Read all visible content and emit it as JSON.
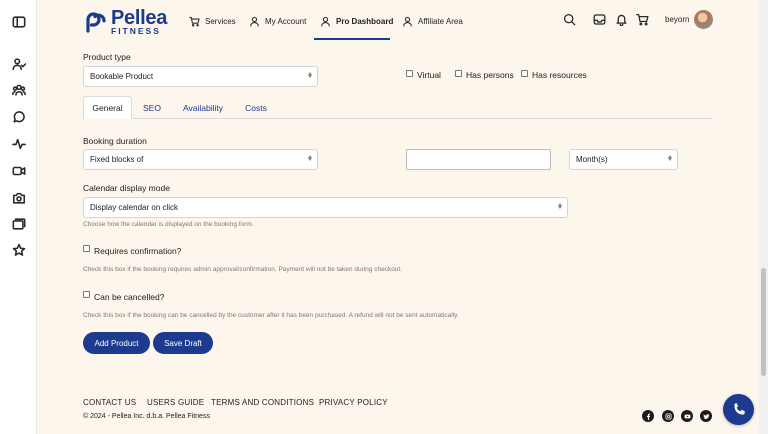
{
  "app": {
    "name": "Pellea",
    "tagline": "FITNESS"
  },
  "sidebar": {
    "items": [
      {
        "icon": "sidebar-toggle-icon"
      },
      {
        "icon": "users-icon"
      },
      {
        "icon": "groups-icon"
      },
      {
        "icon": "chat-icon"
      },
      {
        "icon": "activity-icon"
      },
      {
        "icon": "video-icon"
      },
      {
        "icon": "camera-icon"
      },
      {
        "icon": "gallery-icon"
      },
      {
        "icon": "star-icon"
      }
    ]
  },
  "nav": {
    "services": "Services",
    "my_account": "My Account",
    "pro_dashboard": "Pro Dashboard",
    "affiliate": "Affiliate Area",
    "active": "pro_dashboard"
  },
  "header": {
    "username": "beyorn"
  },
  "form": {
    "product_type_label": "Product type",
    "product_type_value": "Bookable Product",
    "virtual_label": "Virtual",
    "virtual_checked": false,
    "has_persons_label": "Has persons",
    "has_persons_checked": false,
    "has_resources_label": "Has resources",
    "has_resources_checked": false,
    "tabs": [
      "General",
      "SEO",
      "Availability",
      "Costs"
    ],
    "active_tab": "General",
    "booking_duration_label": "Booking duration",
    "booking_duration_type": "Fixed blocks of",
    "booking_duration_value": "",
    "booking_duration_unit": "Month(s)",
    "calendar_mode_label": "Calendar display mode",
    "calendar_mode_value": "Display calendar on click",
    "calendar_mode_help": "Choose how the calendar is displayed on the booking form.",
    "requires_confirmation_label": "Requires confirmation?",
    "requires_confirmation_checked": false,
    "requires_confirmation_help": "Check this box if the booking requires admin approval/confirmation. Payment will not be taken during checkout.",
    "can_be_cancelled_label": "Can be cancelled?",
    "can_be_cancelled_checked": false,
    "can_be_cancelled_help": "Check this box if the booking can be cancelled by the customer after it has been purchased. A refund will not be sent automatically.",
    "add_product": "Add Product",
    "save_draft": "Save Draft"
  },
  "footer": {
    "links": [
      "CONTACT US",
      "USERS GUIDE",
      "TERMS AND CONDITIONS",
      "PRIVACY POLICY"
    ],
    "copyright": "© 2024 - Pellea Inc. d.b.a. Pellea Fitness",
    "social": [
      "facebook-icon",
      "instagram-icon",
      "youtube-icon",
      "twitter-icon"
    ]
  },
  "colors": {
    "brand": "#1c3b8f",
    "page_bg": "#fcf6ec"
  }
}
